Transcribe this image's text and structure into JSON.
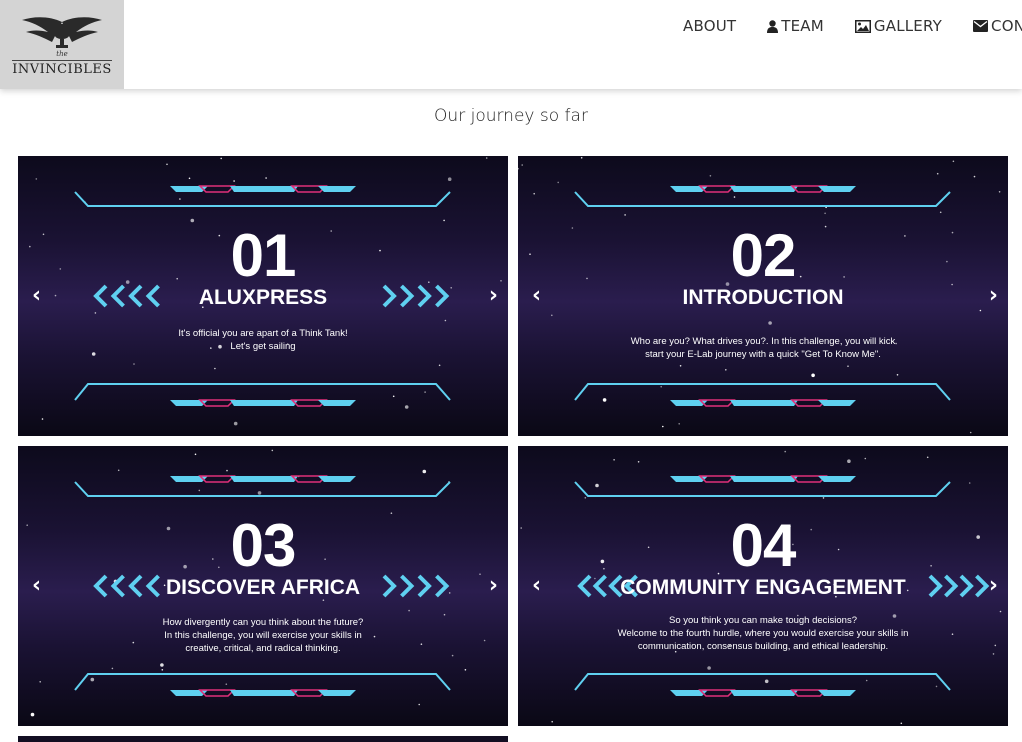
{
  "brand": {
    "top": "the",
    "name": "INVINCIBLES"
  },
  "nav": [
    {
      "label": "ABOUT",
      "icon": ""
    },
    {
      "label": "TEAM",
      "icon": "user-icon"
    },
    {
      "label": "GALLERY",
      "icon": "image-icon"
    },
    {
      "label": "CON",
      "icon": "envelope-icon"
    }
  ],
  "section_title": "Our journey so far",
  "colors": {
    "accent_cyan": "#5fd0f0",
    "accent_pink": "#e0307a",
    "card_bg": "#1a1233"
  },
  "cards": [
    {
      "num": "01",
      "title": "ALUXPRESS",
      "desc": "It's official you are apart of a Think Tank!\nLet's get sailing",
      "prev": "‹",
      "next": "›"
    },
    {
      "num": "02",
      "title": "INTRODUCTION",
      "desc": "Who are you? What drives you?. In this challenge, you will kick\nstart your E-Lab journey with a quick \"Get To Know Me\".",
      "prev": "‹",
      "next": "›"
    },
    {
      "num": "03",
      "title": "DISCOVER AFRICA",
      "desc": "How divergently can you think about the future?\nIn this challenge, you will exercise your skills in\ncreative, critical, and radical thinking.",
      "prev": "‹",
      "next": "›"
    },
    {
      "num": "04",
      "title": "COMMUNITY ENGAGEMENT",
      "desc": "So you think you can make tough decisions?\nWelcome to the fourth hurdle, where you would exercise your skills in\ncommunication, consensus building, and ethical leadership.",
      "prev": "‹",
      "next": "›"
    }
  ]
}
